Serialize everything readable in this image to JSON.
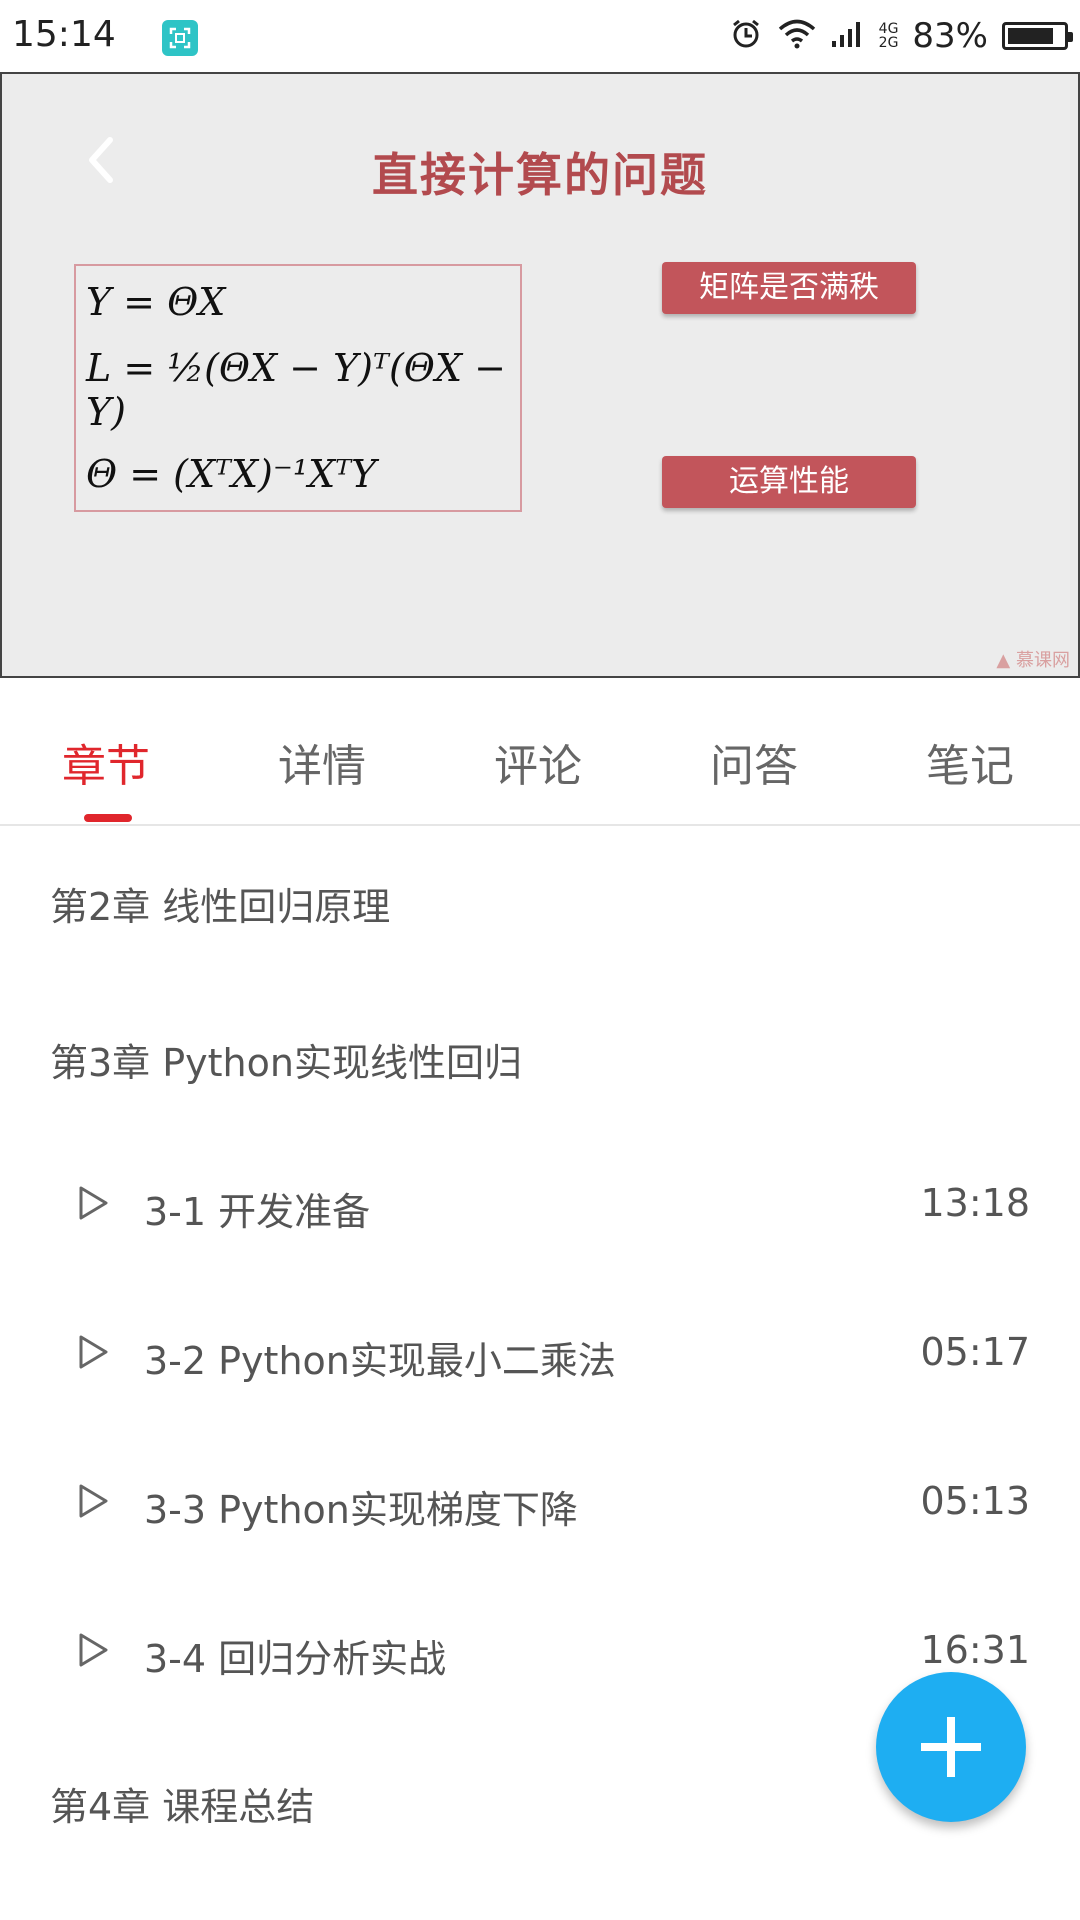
{
  "status_bar": {
    "time": "15:14",
    "network_top": "4G",
    "network_bottom": "2G",
    "battery_percent": "83%",
    "battery_level": 0.83,
    "icons": [
      "screen-capture-icon",
      "alarm-icon",
      "wifi-icon",
      "signal-icon",
      "battery-icon"
    ]
  },
  "video": {
    "slide_title": "直接计算的问题",
    "formulas": [
      "Y = ΘX",
      "L = ½(ΘX − Y)ᵀ(ΘX − Y)",
      "Θ = (XᵀX)⁻¹XᵀY"
    ],
    "buttons": [
      "矩阵是否满秩",
      "运算性能"
    ],
    "watermark": "慕课网"
  },
  "tabs": [
    {
      "label": "章节",
      "active": true
    },
    {
      "label": "详情",
      "active": false
    },
    {
      "label": "评论",
      "active": false
    },
    {
      "label": "问答",
      "active": false
    },
    {
      "label": "笔记",
      "active": false
    }
  ],
  "chapters": [
    {
      "title": "第2章 线性回归原理"
    },
    {
      "title": "第3章 Python实现线性回归"
    },
    {
      "title": "第4章 课程总结"
    }
  ],
  "lessons": [
    {
      "title": "3-1 开发准备",
      "duration": "13:18"
    },
    {
      "title": "3-2 Python实现最小二乘法",
      "duration": "05:17"
    },
    {
      "title": "3-3 Python实现梯度下降",
      "duration": "05:13"
    },
    {
      "title": "3-4 回归分析实战",
      "duration": "16:31"
    }
  ],
  "colors": {
    "accent_red": "#e0262c",
    "slide_red": "#c2555b",
    "fab_blue": "#1eaef2"
  }
}
